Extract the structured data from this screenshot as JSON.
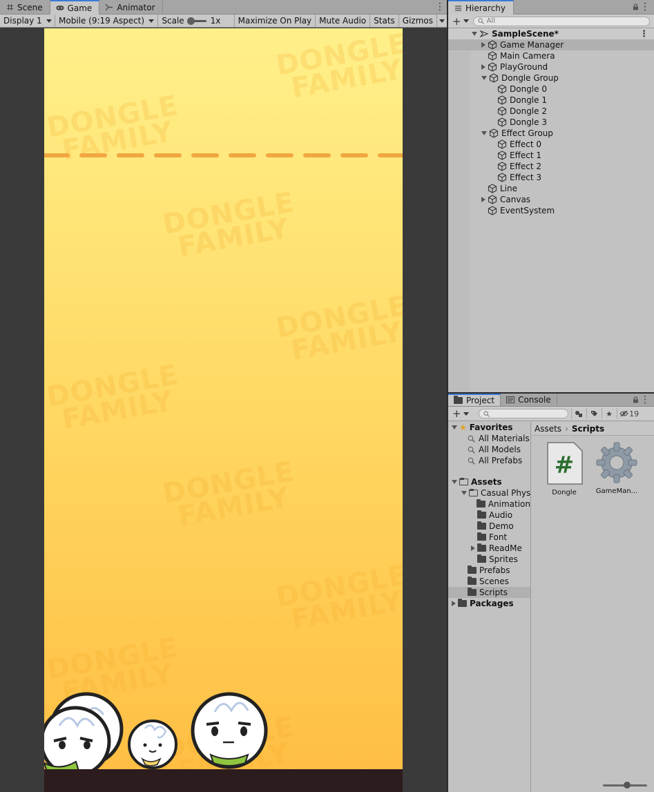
{
  "game_panel": {
    "tabs": [
      {
        "label": "Scene",
        "icon": "grid-icon"
      },
      {
        "label": "Game",
        "icon": "gamepad-icon"
      },
      {
        "label": "Animator",
        "icon": "animator-icon"
      }
    ],
    "toolbar": {
      "display": "Display 1",
      "aspect": "Mobile (9:19 Aspect)",
      "scale_label": "Scale",
      "scale_value": "1x",
      "maximize": "Maximize On Play",
      "mute": "Mute Audio",
      "stats": "Stats",
      "gizmos": "Gizmos"
    },
    "watermark": [
      "DONGLE",
      "FAMILY"
    ],
    "colors": {
      "sky_top": "#fff08a",
      "sky_bottom": "#ffbd42",
      "deadline": "#f2a640",
      "ground": "#2c1c1e"
    }
  },
  "hierarchy": {
    "title": "Hierarchy",
    "search_placeholder": "All",
    "items": [
      {
        "label": "SampleScene*",
        "depth": 0,
        "expand": "open",
        "type": "scene"
      },
      {
        "label": "Game Manager",
        "depth": 1,
        "expand": "closed",
        "type": "object",
        "selected": true
      },
      {
        "label": "Main Camera",
        "depth": 1,
        "expand": "none",
        "type": "object"
      },
      {
        "label": "PlayGround",
        "depth": 1,
        "expand": "closed",
        "type": "object"
      },
      {
        "label": "Dongle Group",
        "depth": 1,
        "expand": "open",
        "type": "object"
      },
      {
        "label": "Dongle 0",
        "depth": 2,
        "expand": "none",
        "type": "object"
      },
      {
        "label": "Dongle 1",
        "depth": 2,
        "expand": "none",
        "type": "object"
      },
      {
        "label": "Dongle 2",
        "depth": 2,
        "expand": "none",
        "type": "object"
      },
      {
        "label": "Dongle 3",
        "depth": 2,
        "expand": "none",
        "type": "object"
      },
      {
        "label": "Effect Group",
        "depth": 1,
        "expand": "open",
        "type": "object"
      },
      {
        "label": "Effect 0",
        "depth": 2,
        "expand": "none",
        "type": "object"
      },
      {
        "label": "Effect 1",
        "depth": 2,
        "expand": "none",
        "type": "object"
      },
      {
        "label": "Effect 2",
        "depth": 2,
        "expand": "none",
        "type": "object"
      },
      {
        "label": "Effect 3",
        "depth": 2,
        "expand": "none",
        "type": "object"
      },
      {
        "label": "Line",
        "depth": 1,
        "expand": "none",
        "type": "object"
      },
      {
        "label": "Canvas",
        "depth": 1,
        "expand": "closed",
        "type": "object"
      },
      {
        "label": "EventSystem",
        "depth": 1,
        "expand": "none",
        "type": "object"
      }
    ]
  },
  "project": {
    "tabs": [
      {
        "label": "Project",
        "icon": "folder-icon"
      },
      {
        "label": "Console",
        "icon": "console-icon"
      }
    ],
    "hidden_count": "19",
    "tree": [
      {
        "label": "Favorites",
        "depth": 0,
        "expand": "open",
        "kind": "favorites",
        "bold": true
      },
      {
        "label": "All Materials",
        "depth": 1,
        "expand": "none",
        "kind": "search"
      },
      {
        "label": "All Models",
        "depth": 1,
        "expand": "none",
        "kind": "search"
      },
      {
        "label": "All Prefabs",
        "depth": 1,
        "expand": "none",
        "kind": "search"
      },
      {
        "label": "",
        "depth": 0,
        "expand": "none",
        "kind": "spacer"
      },
      {
        "label": "Assets",
        "depth": 0,
        "expand": "open",
        "kind": "folder-open",
        "bold": true
      },
      {
        "label": "Casual Phys",
        "depth": 1,
        "expand": "open",
        "kind": "folder-open"
      },
      {
        "label": "Animation",
        "depth": 2,
        "expand": "none",
        "kind": "folder"
      },
      {
        "label": "Audio",
        "depth": 2,
        "expand": "none",
        "kind": "folder"
      },
      {
        "label": "Demo",
        "depth": 2,
        "expand": "none",
        "kind": "folder"
      },
      {
        "label": "Font",
        "depth": 2,
        "expand": "none",
        "kind": "folder"
      },
      {
        "label": "ReadMe",
        "depth": 2,
        "expand": "closed",
        "kind": "folder"
      },
      {
        "label": "Sprites",
        "depth": 2,
        "expand": "none",
        "kind": "folder"
      },
      {
        "label": "Prefabs",
        "depth": 1,
        "expand": "none",
        "kind": "folder"
      },
      {
        "label": "Scenes",
        "depth": 1,
        "expand": "none",
        "kind": "folder"
      },
      {
        "label": "Scripts",
        "depth": 1,
        "expand": "none",
        "kind": "folder",
        "selected": true
      },
      {
        "label": "Packages",
        "depth": 0,
        "expand": "closed",
        "kind": "folder",
        "bold": true
      }
    ],
    "breadcrumb": {
      "root": "Assets",
      "current": "Scripts"
    },
    "assets": [
      {
        "label": "Dongle",
        "icon": "csharp-script-icon"
      },
      {
        "label": "GameMan...",
        "icon": "gear-icon"
      }
    ]
  }
}
